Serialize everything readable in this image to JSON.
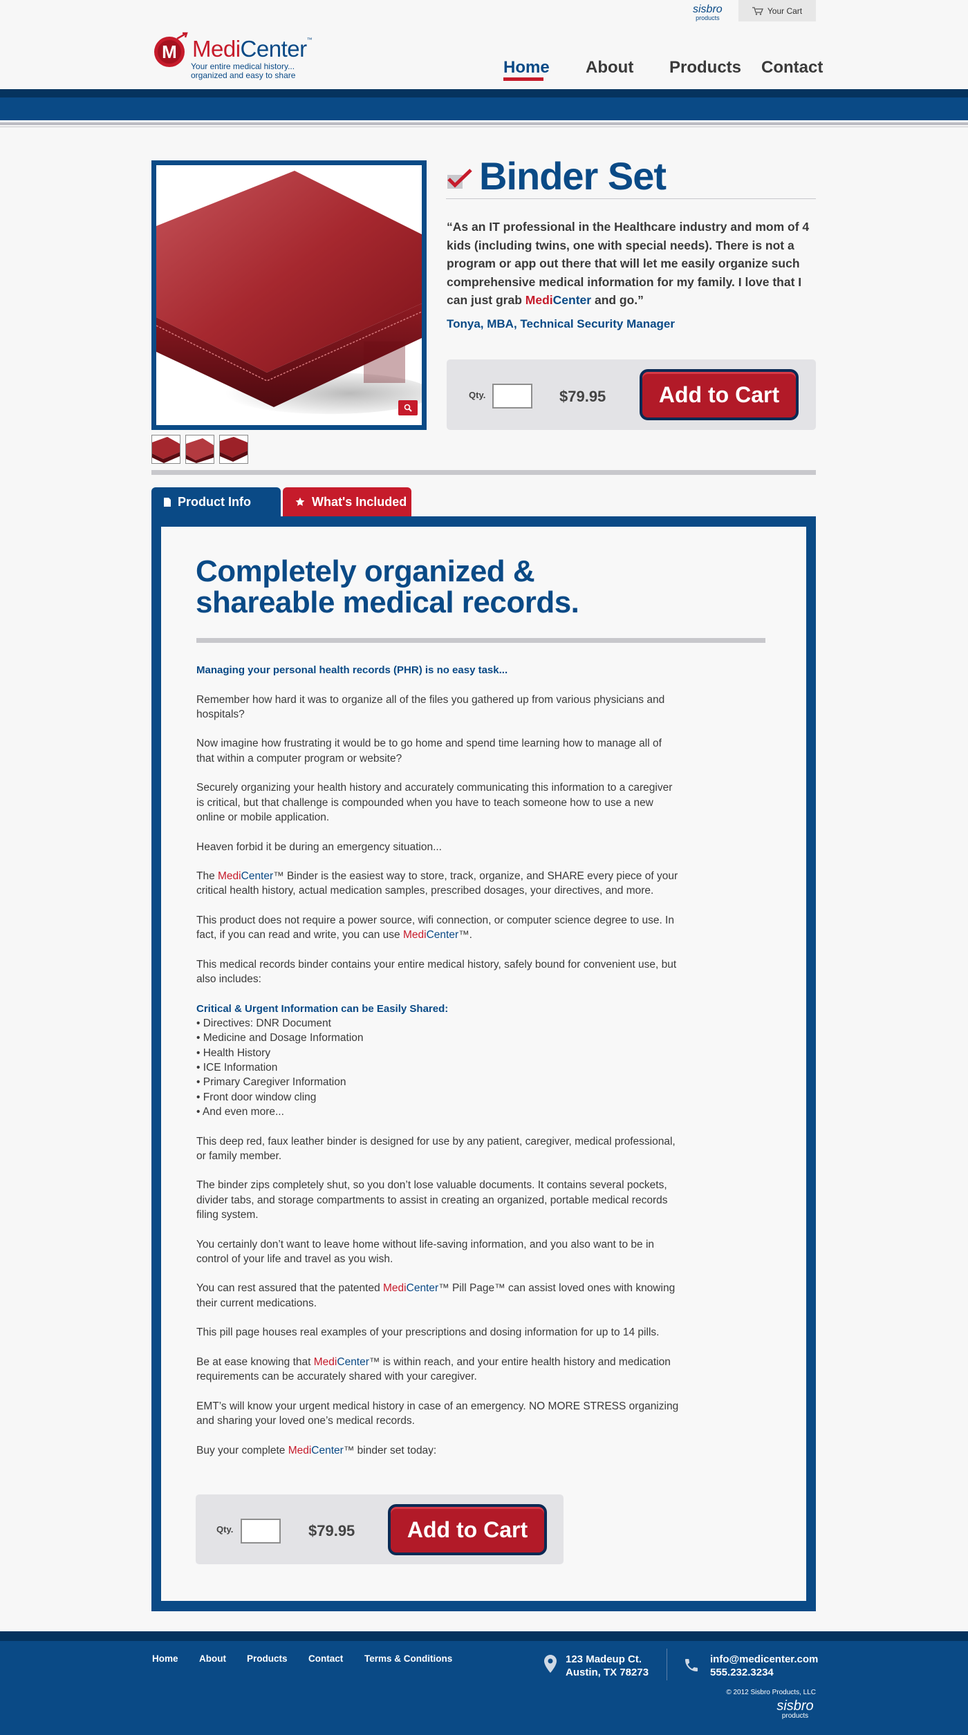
{
  "header": {
    "sisbro_word": "sisbro",
    "sisbro_sub": "products",
    "cart_label": "Your Cart",
    "logo": {
      "medi": "Medi",
      "center": "Center",
      "tm": "™",
      "tagline_line1": "Your entire medical history...",
      "tagline_line2": "organized and easy to share"
    },
    "nav": {
      "home": "Home",
      "about": "About",
      "products": "Products",
      "contact": "Contact",
      "active": "Home"
    }
  },
  "product": {
    "title": "Binder Set",
    "quote_part1": "“As an IT professional in the Healthcare industry and mom of 4 kids (including twins, one with special needs). There is not a program or app out there that will let me easily organize such comprehensive medical information for my family. I love that I can just grab ",
    "quote_medi": "Medi",
    "quote_center": "Center",
    "quote_part2": " and go.”",
    "quote_author": "Tonya, MBA, Technical Security Manager",
    "thumbnail_count": 3
  },
  "buybox": {
    "qty_label": "Qty.",
    "qty_value": "",
    "price": "$79.95",
    "add_to_cart": "Add to Cart"
  },
  "tabs": {
    "product_info": "Product Info",
    "whats_included": "What's Included",
    "active": "Product Info"
  },
  "content": {
    "title": "Completely organized & shareable medical records.",
    "lead": "Managing your personal health records (PHR) is no easy task...",
    "p1": "Remember how hard it was to organize all of the files you gathered up from various physicians and hospitals?",
    "p2": "Now imagine how frustrating it would be to go home and spend time learning how to manage all of that within a computer program or website?",
    "p3": "Securely organizing your health history and accurately communicating this information to a caregiver is critical, but that challenge is compounded when you have to teach someone how to use a new online or mobile application.",
    "p4": "Heaven forbid it be during an emergency situation...",
    "p5_pre": "The ",
    "p5_post": "™ Binder is the easiest way to store, track, organize, and SHARE every piece of your critical health history, actual medication samples, prescribed dosages, your directives, and more.",
    "p6_pre": "This product does not require a power source, wifi connection, or computer science degree to use. In fact, if you can read and write, you can use ",
    "p6_post": "™.",
    "p7": "This medical records binder contains your entire medical history, safely bound for convenient use, but also includes:",
    "list_heading": "Critical & Urgent Information can be Easily Shared:",
    "list_items": [
      "• Directives: DNR Document",
      "• Medicine and Dosage Information",
      "• Health History",
      "• ICE Information",
      "• Primary Caregiver Information",
      "• Front door window cling",
      "• And even more..."
    ],
    "p8": "This deep red, faux leather binder is designed for use by any patient, caregiver, medical professional, or family member.",
    "p9": "The binder zips completely shut, so you don’t lose valuable documents. It contains several pockets, divider tabs, and storage compartments to assist in creating an organized, portable medical records filing system.",
    "p10": "You certainly don’t want to leave home without life-saving information, and you also want to be in control of your life and travel as you wish.",
    "p11_pre": "You can rest assured that the patented ",
    "p11_post": "™ Pill Page™ can assist loved ones with knowing their current medications.",
    "p12": "This pill page houses real examples of your prescriptions and dosing information for up to 14 pills.",
    "p13_pre": "Be at ease knowing that ",
    "p13_post": "™ is within reach, and your entire health history and medication requirements can be accurately shared with your caregiver.",
    "p14": "EMT’s will know your urgent medical history in case of an emergency. NO MORE STRESS organizing and sharing your loved one’s medical records.",
    "p15_pre": "Buy your complete ",
    "p15_post": "™ binder set today:",
    "brand_medi": "Medi",
    "brand_center": "Center"
  },
  "footer": {
    "links": [
      "Home",
      "About",
      "Products",
      "Contact",
      "Terms & Conditions"
    ],
    "address_line1": "123 Madeup Ct.",
    "address_line2": "Austin, TX 78273",
    "email": "info@medicenter.com",
    "phone": "555.232.3234",
    "copyright": "© 2012 Sisbro Products, LLC",
    "sisbro_word": "sisbro",
    "sisbro_sub": "products"
  },
  "colors": {
    "brand_blue": "#0a4a86",
    "brand_red": "#c61b2b",
    "background": "#f7f7f7",
    "rule_gray": "#c8c8cc"
  },
  "icons": [
    "cart-icon",
    "logo-m-icon",
    "checkmark-icon",
    "zoom-icon",
    "document-icon",
    "star-icon",
    "map-pin-icon",
    "phone-icon"
  ]
}
